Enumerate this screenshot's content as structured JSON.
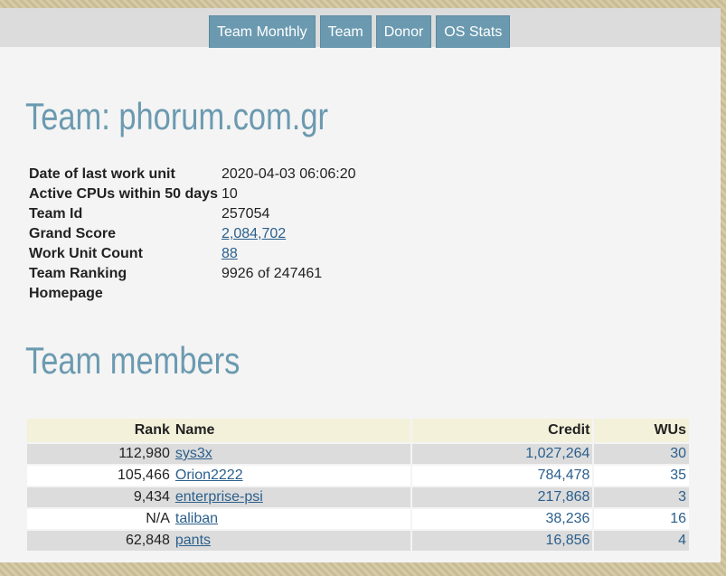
{
  "tabs": [
    "Team Monthly",
    "Team",
    "Donor",
    "OS Stats"
  ],
  "title": "Team: phorum.com.gr",
  "info": [
    {
      "label": "Date of last work unit",
      "value": "2020-04-03 06:06:20",
      "link": false
    },
    {
      "label": "Active CPUs within 50 days",
      "value": "10",
      "link": false
    },
    {
      "label": "Team Id",
      "value": "257054",
      "link": false
    },
    {
      "label": "Grand Score",
      "value": "2,084,702",
      "link": true
    },
    {
      "label": "Work Unit Count",
      "value": "88",
      "link": true
    },
    {
      "label": "Team Ranking",
      "value": "9926 of 247461",
      "link": false
    },
    {
      "label": "Homepage",
      "value": "",
      "link": false
    }
  ],
  "members_title": "Team members",
  "members": {
    "headers": {
      "rank": "Rank",
      "name": "Name",
      "credit": "Credit",
      "wus": "WUs"
    },
    "rows": [
      {
        "rank": "112,980",
        "name": "sys3x",
        "credit": "1,027,264",
        "wus": "30"
      },
      {
        "rank": "105,466",
        "name": "Orion2222",
        "credit": "784,478",
        "wus": "35"
      },
      {
        "rank": "9,434",
        "name": "enterprise-psi",
        "credit": "217,868",
        "wus": "3"
      },
      {
        "rank": "N/A",
        "name": "taliban",
        "credit": "38,236",
        "wus": "16"
      },
      {
        "rank": "62,848",
        "name": "pants",
        "credit": "16,856",
        "wus": "4"
      }
    ]
  }
}
